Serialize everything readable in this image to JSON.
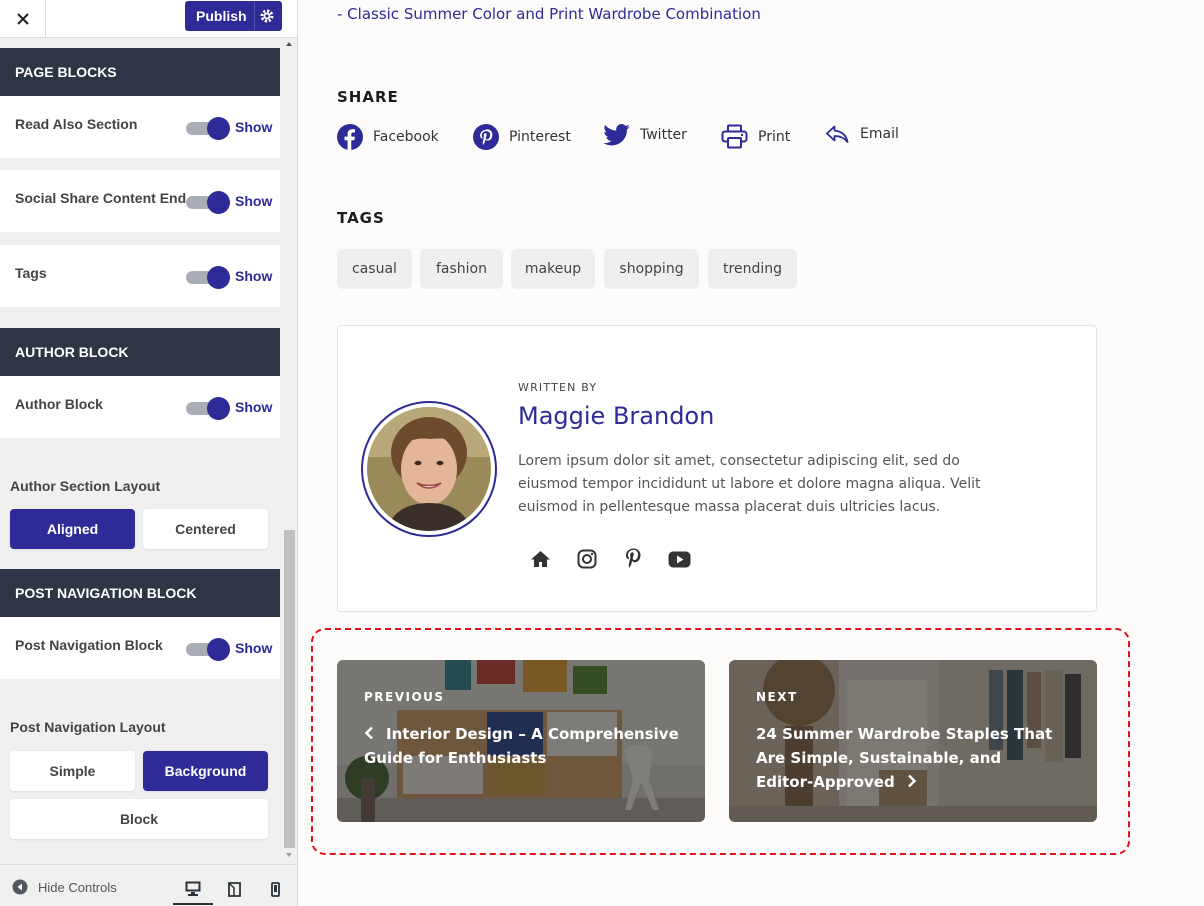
{
  "sidebar": {
    "publish_label": "Publish",
    "sections": {
      "page_blocks": "PAGE BLOCKS",
      "author_block": "AUTHOR BLOCK",
      "post_navigation_block": "POST NAVIGATION BLOCK"
    },
    "toggles": [
      {
        "label": "Read Also Section",
        "state": "Show"
      },
      {
        "label": "Social Share Content End",
        "state": "Show"
      },
      {
        "label": "Tags",
        "state": "Show"
      },
      {
        "label": "Author Block",
        "state": "Show"
      },
      {
        "label": "Post Navigation Block",
        "state": "Show"
      }
    ],
    "author_layout": {
      "label": "Author Section Layout",
      "options": [
        "Aligned",
        "Centered"
      ],
      "selected": "Aligned"
    },
    "post_nav_layout": {
      "label": "Post Navigation Layout",
      "options": [
        "Simple",
        "Background",
        "Block"
      ],
      "selected": "Background"
    },
    "footer": {
      "hide_controls": "Hide Controls"
    }
  },
  "main": {
    "related_link": "-  Classic Summer Color and Print Wardrobe Combination",
    "share": {
      "heading": "SHARE",
      "items": [
        {
          "label": "Facebook",
          "icon": "facebook-icon"
        },
        {
          "label": "Pinterest",
          "icon": "pinterest-icon"
        },
        {
          "label": "Twitter",
          "icon": "twitter-icon"
        },
        {
          "label": "Print",
          "icon": "print-icon"
        },
        {
          "label": "Email",
          "icon": "email-icon"
        }
      ]
    },
    "tags": {
      "heading": "TAGS",
      "items": [
        "casual",
        "fashion",
        "makeup",
        "shopping",
        "trending"
      ]
    },
    "author": {
      "written_by": "WRITTEN BY",
      "name": "Maggie Brandon",
      "bio": "Lorem ipsum dolor sit amet, consectetur adipiscing elit, sed do eiusmod tempor incididunt ut labore et dolore magna aliqua. Velit euismod in pellentesque massa placerat duis ultricies lacus.",
      "social": [
        "home-icon",
        "instagram-icon",
        "pinterest-icon",
        "youtube-icon"
      ]
    },
    "post_navigation": {
      "previous": {
        "kicker": "PREVIOUS",
        "title": "Interior Design – A Comprehensive Guide for Enthusiasts"
      },
      "next": {
        "kicker": "NEXT",
        "title": "24 Summer Wardrobe Staples That Are Simple, Sustainable, and Editor-Approved"
      }
    }
  },
  "colors": {
    "accent": "#2e2a97",
    "section_header": "#2e3646",
    "highlight_dash": "#e0121b"
  }
}
